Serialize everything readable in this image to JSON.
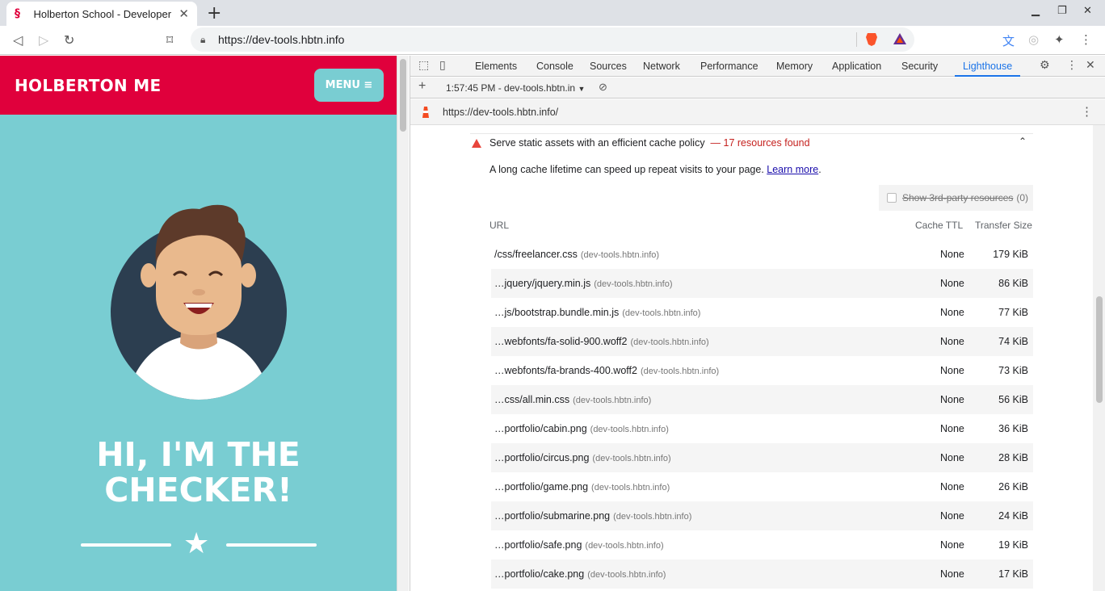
{
  "browser": {
    "tab_title": "Holberton School - Developer",
    "url": "https://dev-tools.hbtn.info"
  },
  "page": {
    "brand": "HOLBERTON ME",
    "menu_label": "MENU ≡",
    "hero_line1": "HI, I'M THE",
    "hero_line2": "CHECKER!"
  },
  "devtools": {
    "tabs": [
      "Elements",
      "Console",
      "Sources",
      "Network",
      "Performance",
      "Memory",
      "Application",
      "Security",
      "Lighthouse"
    ],
    "active_tab": "Lighthouse",
    "report_selector": "1:57:45 PM - dev-tools.hbtn.in",
    "report_url": "https://dev-tools.hbtn.info/",
    "audit": {
      "title": "Serve static assets with an efficient cache policy",
      "found": "— 17 resources found",
      "description": "A long cache lifetime can speed up repeat visits to your page.",
      "learn_more": "Learn more",
      "desc_end": ".",
      "third_party_label": "Show 3rd-party resources",
      "third_party_count": "(0)",
      "columns": {
        "url": "URL",
        "ttl": "Cache TTL",
        "size": "Transfer Size"
      },
      "rows": [
        {
          "url": "/css/freelancer.css",
          "host": "(dev-tools.hbtn.info)",
          "ttl": "None",
          "size": "179 KiB"
        },
        {
          "url": "…jquery/jquery.min.js",
          "host": "(dev-tools.hbtn.info)",
          "ttl": "None",
          "size": "86 KiB"
        },
        {
          "url": "…js/bootstrap.bundle.min.js",
          "host": "(dev-tools.hbtn.info)",
          "ttl": "None",
          "size": "77 KiB"
        },
        {
          "url": "…webfonts/fa-solid-900.woff2",
          "host": "(dev-tools.hbtn.info)",
          "ttl": "None",
          "size": "74 KiB"
        },
        {
          "url": "…webfonts/fa-brands-400.woff2",
          "host": "(dev-tools.hbtn.info)",
          "ttl": "None",
          "size": "73 KiB"
        },
        {
          "url": "…css/all.min.css",
          "host": "(dev-tools.hbtn.info)",
          "ttl": "None",
          "size": "56 KiB"
        },
        {
          "url": "…portfolio/cabin.png",
          "host": "(dev-tools.hbtn.info)",
          "ttl": "None",
          "size": "36 KiB"
        },
        {
          "url": "…portfolio/circus.png",
          "host": "(dev-tools.hbtn.info)",
          "ttl": "None",
          "size": "28 KiB"
        },
        {
          "url": "…portfolio/game.png",
          "host": "(dev-tools.hbtn.info)",
          "ttl": "None",
          "size": "26 KiB"
        },
        {
          "url": "…portfolio/submarine.png",
          "host": "(dev-tools.hbtn.info)",
          "ttl": "None",
          "size": "24 KiB"
        },
        {
          "url": "…portfolio/safe.png",
          "host": "(dev-tools.hbtn.info)",
          "ttl": "None",
          "size": "19 KiB"
        },
        {
          "url": "…portfolio/cake.png",
          "host": "(dev-tools.hbtn.info)",
          "ttl": "None",
          "size": "17 KiB"
        }
      ]
    }
  },
  "colors": {
    "accent": "#e0003c",
    "teal": "#79cdd2",
    "navy": "#2c3e50",
    "link": "#1a73e8"
  },
  "icons": [
    "seahorse-favicon",
    "back-icon",
    "forward-icon",
    "reload-icon",
    "bookmark-icon",
    "lock-icon",
    "brave-icon",
    "bat-icon",
    "translate-icon",
    "extensions-icon",
    "kebab-menu-icon",
    "inspect-icon",
    "device-icon",
    "settings-icon",
    "close-icon",
    "warning-icon",
    "chevron-up-icon",
    "star-icon"
  ]
}
